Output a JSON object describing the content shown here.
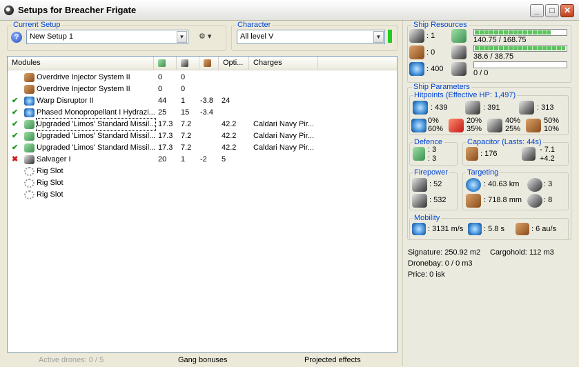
{
  "window": {
    "title": "Setups for Breacher Frigate"
  },
  "current_setup": {
    "label": "Current Setup",
    "value": "New Setup 1"
  },
  "character": {
    "label": "Character",
    "value": "All level V"
  },
  "modules": {
    "columns": [
      "Modules",
      "Opti...",
      "Charges"
    ],
    "rows": [
      {
        "status": "",
        "icon": "overdrive-injector-icon",
        "name": "Overdrive Injector System II",
        "c1": "0",
        "c2": "0",
        "c3": "",
        "c4": "",
        "charges": ""
      },
      {
        "status": "",
        "icon": "overdrive-injector-icon",
        "name": "Overdrive Injector System II",
        "c1": "0",
        "c2": "0",
        "c3": "",
        "c4": "",
        "charges": ""
      },
      {
        "status": "✔",
        "icon": "warp-disruptor-icon",
        "name": "Warp Disruptor II",
        "c1": "44",
        "c2": "1",
        "c3": "-3.8",
        "c4": "24",
        "charges": ""
      },
      {
        "status": "✔",
        "icon": "microwarpdrive-icon",
        "name": "Phased Monopropellant I Hydrazi...",
        "c1": "25",
        "c2": "15",
        "c3": "-3.4",
        "c4": "",
        "charges": ""
      },
      {
        "status": "✔",
        "icon": "missile-launcher-icon",
        "name": "Upgraded 'Limos' Standard Missil...",
        "c1": "17.3",
        "c2": "7.2",
        "c3": "",
        "c4": "42.2",
        "charges": "Caldari Navy Pir..."
      },
      {
        "status": "✔",
        "icon": "missile-launcher-icon",
        "name": "Upgraded 'Limos' Standard Missil...",
        "c1": "17.3",
        "c2": "7.2",
        "c3": "",
        "c4": "42.2",
        "charges": "Caldari Navy Pir..."
      },
      {
        "status": "✔",
        "icon": "missile-launcher-icon",
        "name": "Upgraded 'Limos' Standard Missil...",
        "c1": "17.3",
        "c2": "7.2",
        "c3": "",
        "c4": "42.2",
        "charges": "Caldari Navy Pir..."
      },
      {
        "status": "✖",
        "icon": "salvager-icon",
        "name": "Salvager I",
        "c1": "20",
        "c2": "1",
        "c3": "-2",
        "c4": "5",
        "charges": ""
      },
      {
        "status": "",
        "icon": "rig-slot-icon",
        "name": "Rig Slot",
        "c1": "",
        "c2": "",
        "c3": "",
        "c4": "",
        "charges": ""
      },
      {
        "status": "",
        "icon": "rig-slot-icon",
        "name": "Rig Slot",
        "c1": "",
        "c2": "",
        "c3": "",
        "c4": "",
        "charges": ""
      },
      {
        "status": "",
        "icon": "rig-slot-icon",
        "name": "Rig Slot",
        "c1": "",
        "c2": "",
        "c3": "",
        "c4": "",
        "charges": ""
      }
    ]
  },
  "statusbar": {
    "drones": "Active drones: 0 / 5",
    "gang": "Gang bonuses",
    "projected": "Projected effects"
  },
  "resources": {
    "label": "Ship Resources",
    "turret_hardpoints": ": 1",
    "launcher_hardpoints": ": 0",
    "calibration": ": 400",
    "cpu": "140.75 / 168.75",
    "cpu_fraction": 0.834,
    "powergrid": "38.6 / 38.75",
    "powergrid_fraction": 0.996,
    "drone_bandwidth": "0 / 0",
    "drone_fraction": 0
  },
  "parameters": {
    "label": "Ship Parameters",
    "hitpoints": {
      "label": "Hitpoints (Effective HP: 1,497)",
      "shield": ": 439",
      "armor": ": 391",
      "structure": ": 313",
      "em": [
        "0%",
        "60%"
      ],
      "thermal": [
        "20%",
        "35%"
      ],
      "kinetic": [
        "40%",
        "25%"
      ],
      "explosive": [
        "50%",
        "10%"
      ]
    },
    "defence": {
      "label": "Defence",
      "a": ": 3",
      "b": ": 3"
    },
    "capacitor": {
      "label": "Capacitor (Lasts: 44s)",
      "amount": ": 176",
      "delta": [
        "- 7.1",
        "+4.2"
      ]
    },
    "firepower": {
      "label": "Firepower",
      "dps": ": 52",
      "volley": ": 532"
    },
    "targeting": {
      "label": "Targeting",
      "range": ": 40.63 km",
      "max_targets": ": 3",
      "scan_res": ": 718.8 mm",
      "sensor": ": 8"
    },
    "mobility": {
      "label": "Mobility",
      "speed": ": 3131 m/s",
      "align": ": 5.8 s",
      "warp": ": 6 au/s"
    },
    "signature": "Signature: 250.92 m2",
    "cargohold": "Cargohold: 112 m3",
    "dronebay": "Dronebay: 0 / 0 m3",
    "price": "Price: 0 isk"
  }
}
